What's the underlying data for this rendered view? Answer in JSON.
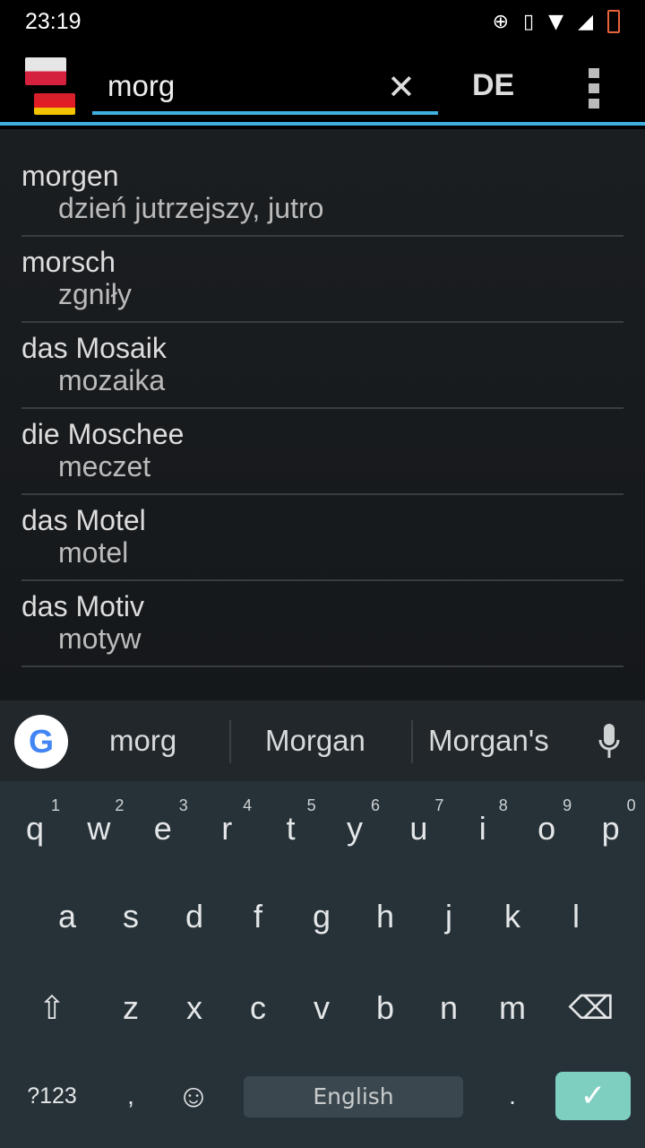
{
  "status": {
    "time": "23:19"
  },
  "appbar": {
    "search_value": "morg",
    "lang": "DE"
  },
  "entries": [
    {
      "word": "morgen",
      "translation": "dzień jutrzejszy, jutro"
    },
    {
      "word": "morsch",
      "translation": "zgniły"
    },
    {
      "word": "das Mosaik",
      "translation": "mozaika"
    },
    {
      "word": "die Moschee",
      "translation": "meczet"
    },
    {
      "word": "das Motel",
      "translation": "motel"
    },
    {
      "word": "das Motiv",
      "translation": "motyw"
    }
  ],
  "suggestions": [
    "morg",
    "Morgan",
    "Morgan's"
  ],
  "keyboard": {
    "row1": [
      "q",
      "w",
      "e",
      "r",
      "t",
      "y",
      "u",
      "i",
      "o",
      "p"
    ],
    "row1_hints": [
      "1",
      "2",
      "3",
      "4",
      "5",
      "6",
      "7",
      "8",
      "9",
      "0"
    ],
    "row2": [
      "a",
      "s",
      "d",
      "f",
      "g",
      "h",
      "j",
      "k",
      "l"
    ],
    "row3": [
      "z",
      "x",
      "c",
      "v",
      "b",
      "n",
      "m"
    ],
    "symbols": "?123",
    "comma": ",",
    "period": ".",
    "space": "English"
  },
  "colors": {
    "accent": "#3fb0e0",
    "keyboard_bg": "#263238",
    "enter": "#7fcfc1"
  }
}
